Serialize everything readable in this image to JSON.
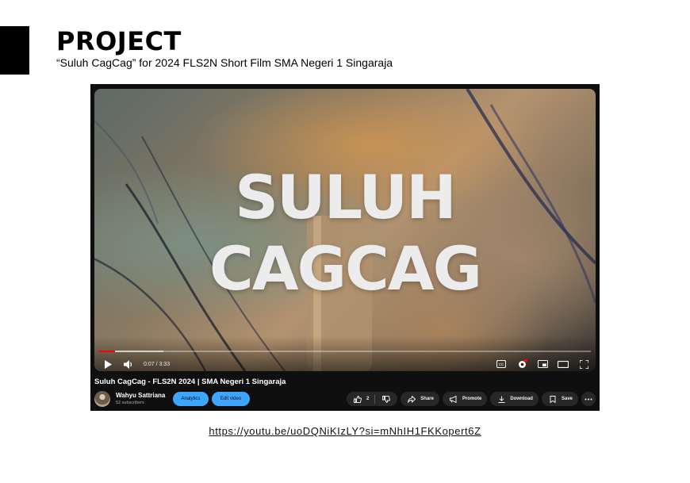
{
  "header": {
    "title": "PROJECT",
    "subtitle": "“Suluh CagCag” for 2024 FLS2N Short Film SMA Negeri 1 Singaraja"
  },
  "player": {
    "overlay_line1": "SULUH",
    "overlay_line2": "CAGCAG",
    "time": "0:07 / 3:33",
    "progress_fraction": 0.033,
    "accent_color": "#ff0000"
  },
  "video_info": {
    "title": "Suluh CagCag - FLS2N 2024 | SMA Negeri 1 Singaraja",
    "channel": "Wahyu Sattriana",
    "subscribers": "52 subscribers",
    "analytics_label": "Analytics",
    "edit_label": "Edit video",
    "like_count": "2",
    "share_label": "Share",
    "promote_label": "Promote",
    "download_label": "Download",
    "save_label": "Save"
  },
  "link": {
    "url": "https://youtu.be/uoDQNiKIzLY?si=mNhIH1FKKopert6Z"
  }
}
